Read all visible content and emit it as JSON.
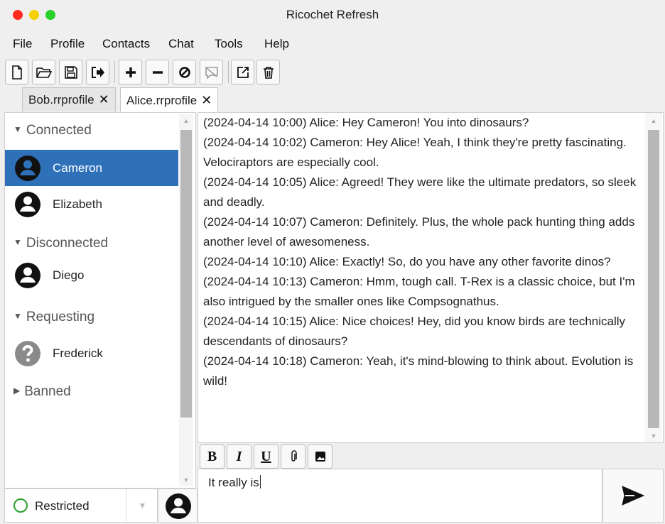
{
  "window": {
    "title": "Ricochet Refresh"
  },
  "menu": {
    "items": [
      "File",
      "Profile",
      "Contacts",
      "Chat",
      "Tools",
      "Help"
    ]
  },
  "toolbar": {
    "buttons": [
      {
        "icon": "new-file-icon",
        "glyph": "🗋"
      },
      {
        "icon": "open-folder-icon",
        "glyph": "🗁"
      },
      {
        "icon": "save-icon",
        "glyph": "🖫"
      },
      {
        "icon": "export-icon",
        "glyph": "➥"
      },
      {
        "icon": "add-icon",
        "glyph": "✚"
      },
      {
        "icon": "remove-icon",
        "glyph": "━"
      },
      {
        "icon": "block-icon",
        "glyph": "⊘"
      },
      {
        "icon": "ban-icon",
        "glyph": "▨"
      },
      {
        "icon": "open-external-icon",
        "glyph": "⧉"
      },
      {
        "icon": "trash-icon",
        "glyph": "🗑"
      }
    ]
  },
  "tabs": [
    {
      "label": "Bob.rrprofile",
      "active": false
    },
    {
      "label": "Alice.rrprofile",
      "active": true
    }
  ],
  "contacts": {
    "groups": [
      {
        "label": "Connected",
        "expanded": true,
        "members": [
          "Cameron",
          "Elizabeth"
        ]
      },
      {
        "label": "Disconnected",
        "expanded": true,
        "members": [
          "Diego"
        ]
      },
      {
        "label": "Requesting",
        "expanded": true,
        "members": [
          "Frederick"
        ]
      },
      {
        "label": "Banned",
        "expanded": false,
        "members": []
      }
    ],
    "selected": "Cameron"
  },
  "status": {
    "label": "Restricted",
    "color": "#2aa02a"
  },
  "messages": [
    "(2024-04-14 10:00) Alice: Hey Cameron! You into dinosaurs?",
    "(2024-04-14 10:02) Cameron: Hey Alice! Yeah, I think they're pretty fascinating. Velociraptors are especially cool.",
    "(2024-04-14 10:05) Alice: Agreed! They were like the ultimate predators, so sleek and deadly.",
    "(2024-04-14 10:07) Cameron: Definitely. Plus, the whole pack hunting thing adds another level of awesomeness.",
    "(2024-04-14 10:10) Alice: Exactly! So, do you have any other favorite dinos?",
    "(2024-04-14 10:13) Cameron: Hmm, tough call. T-Rex is a classic choice, but I'm also intrigued by the smaller ones like Compsognathus.",
    "(2024-04-14 10:15) Alice: Nice choices! Hey, did you know birds are technically descendants of dinosaurs?",
    "(2024-04-14 10:18) Cameron: Yeah, it's mind-blowing to think about. Evolution is wild!"
  ],
  "format": {
    "bold": "B",
    "italic": "I",
    "underline": "U"
  },
  "composer": {
    "text": "It really is"
  },
  "colors": {
    "selected": "#2e71b8"
  }
}
